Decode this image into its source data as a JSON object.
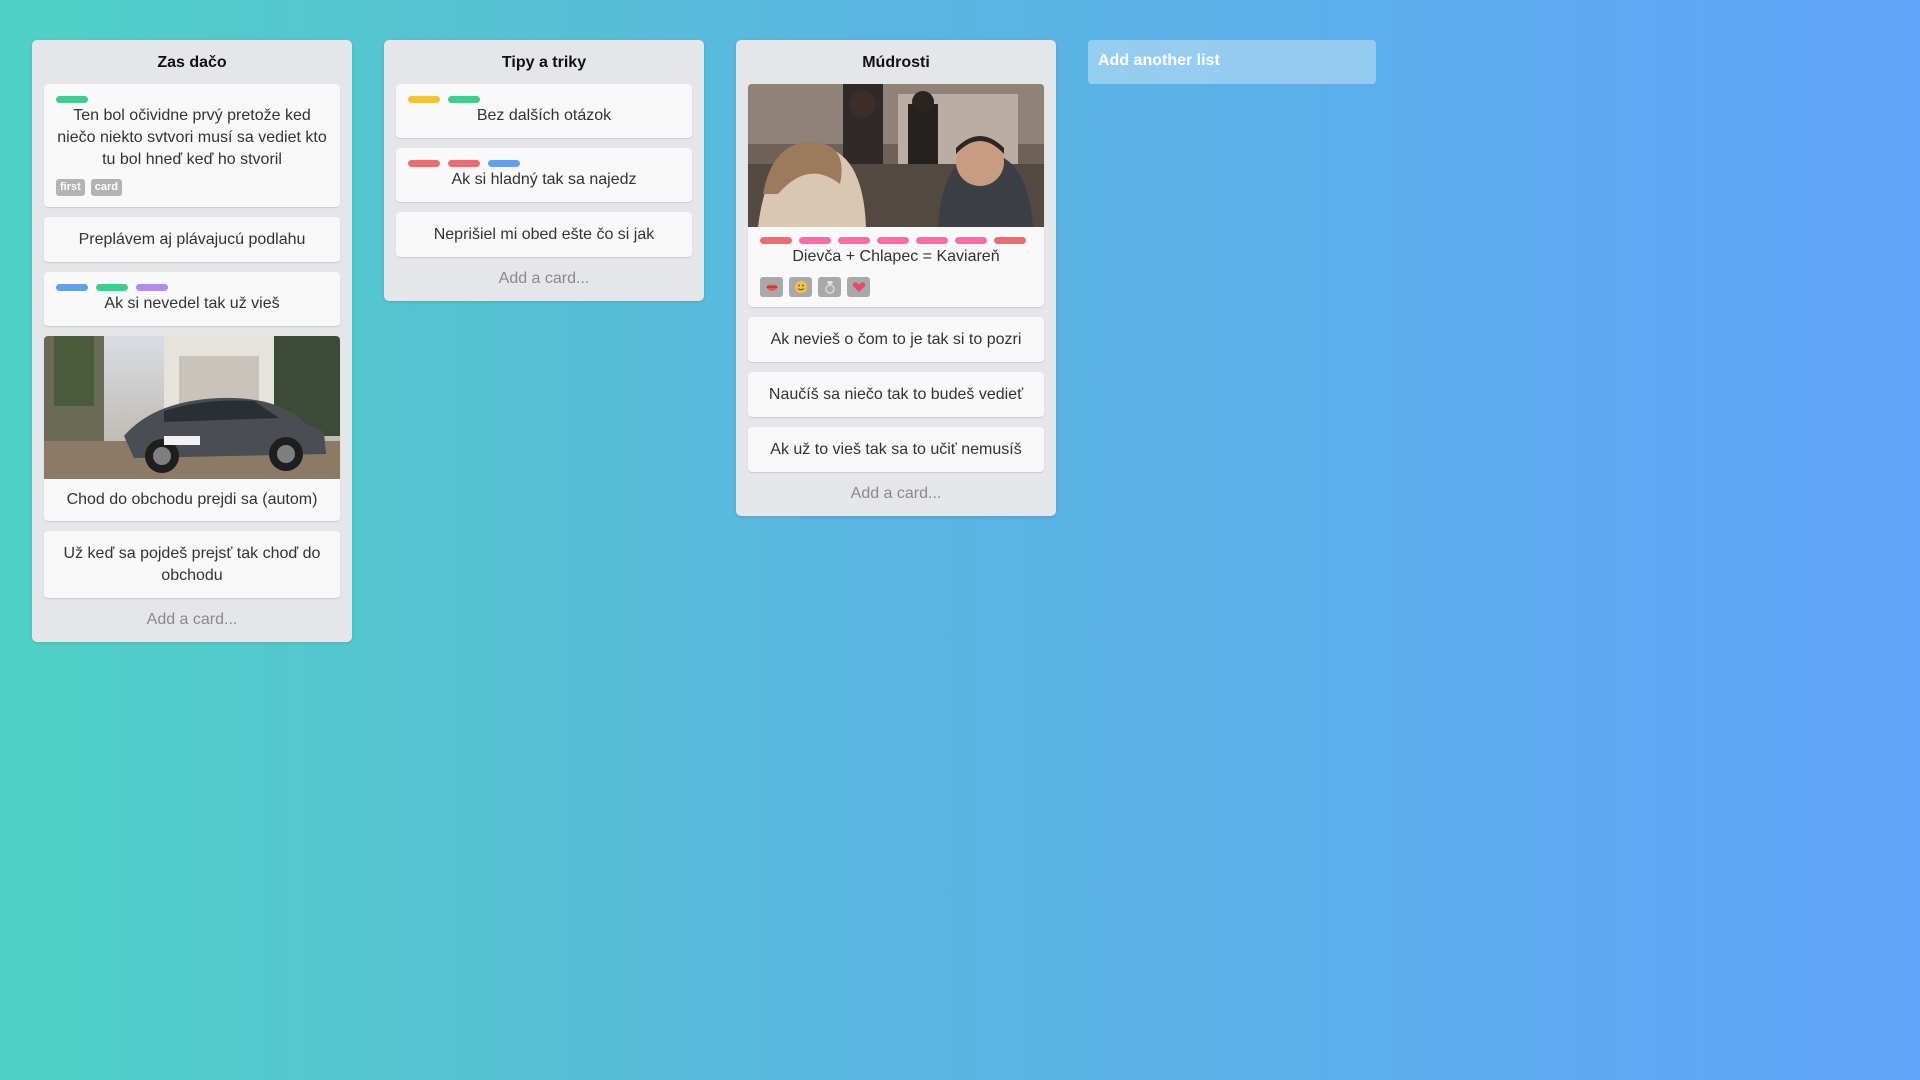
{
  "colors": {
    "green": "#3ecf8e",
    "yellow": "#f5c431",
    "red": "#eb6d72",
    "blue": "#5fa0f0",
    "purple": "#b18cf0",
    "pink": "#f070a8"
  },
  "lists": [
    {
      "title": "Zas dačo",
      "cards": [
        {
          "labels": [
            "green"
          ],
          "text": "Ten bol očividne prvý pretože ked niečo niekto svtvori musí sa vediet kto tu bol hneď keď ho stvoril",
          "badges": [
            "first",
            "card"
          ]
        },
        {
          "labels": [],
          "text": "Preplávem aj plávajucú podlahu"
        },
        {
          "labels": [
            "blue",
            "green",
            "purple"
          ],
          "text": "Ak si nevedel tak už vieš"
        },
        {
          "image": "car-photo",
          "labels": [],
          "text": "Chod do obchodu prejdi sa (autom)"
        },
        {
          "labels": [],
          "text": "Už keď sa pojdeš prejsť tak choď do obchodu"
        }
      ],
      "add_card": "Add a card..."
    },
    {
      "title": "Tipy a triky",
      "cards": [
        {
          "labels": [
            "yellow",
            "green"
          ],
          "text": "Bez dalších otázok"
        },
        {
          "labels": [
            "red",
            "red",
            "blue"
          ],
          "text": "Ak si hladný tak sa najedz"
        },
        {
          "labels": [],
          "text": "Neprišiel mi obed ešte čo si jak"
        }
      ],
      "add_card": "Add a card..."
    },
    {
      "title": "Múdrosti",
      "cards": [
        {
          "image": "cafe-photo",
          "labels": [
            "red",
            "pink",
            "pink",
            "pink",
            "pink",
            "pink",
            "red"
          ],
          "text": "Dievča + Chlapec = Kaviareň",
          "emoji_badges": [
            "lips-icon",
            "smile-icon",
            "ring-icon",
            "heart-icon"
          ]
        },
        {
          "labels": [],
          "text": "Ak nevieš o čom to je tak si to pozri"
        },
        {
          "labels": [],
          "text": "Naučíš sa niečo tak to budeš vedieť"
        },
        {
          "labels": [],
          "text": "Ak už to vieš tak sa to učiť nemusíš"
        }
      ],
      "add_card": "Add a card..."
    }
  ],
  "add_list": "Add another list"
}
